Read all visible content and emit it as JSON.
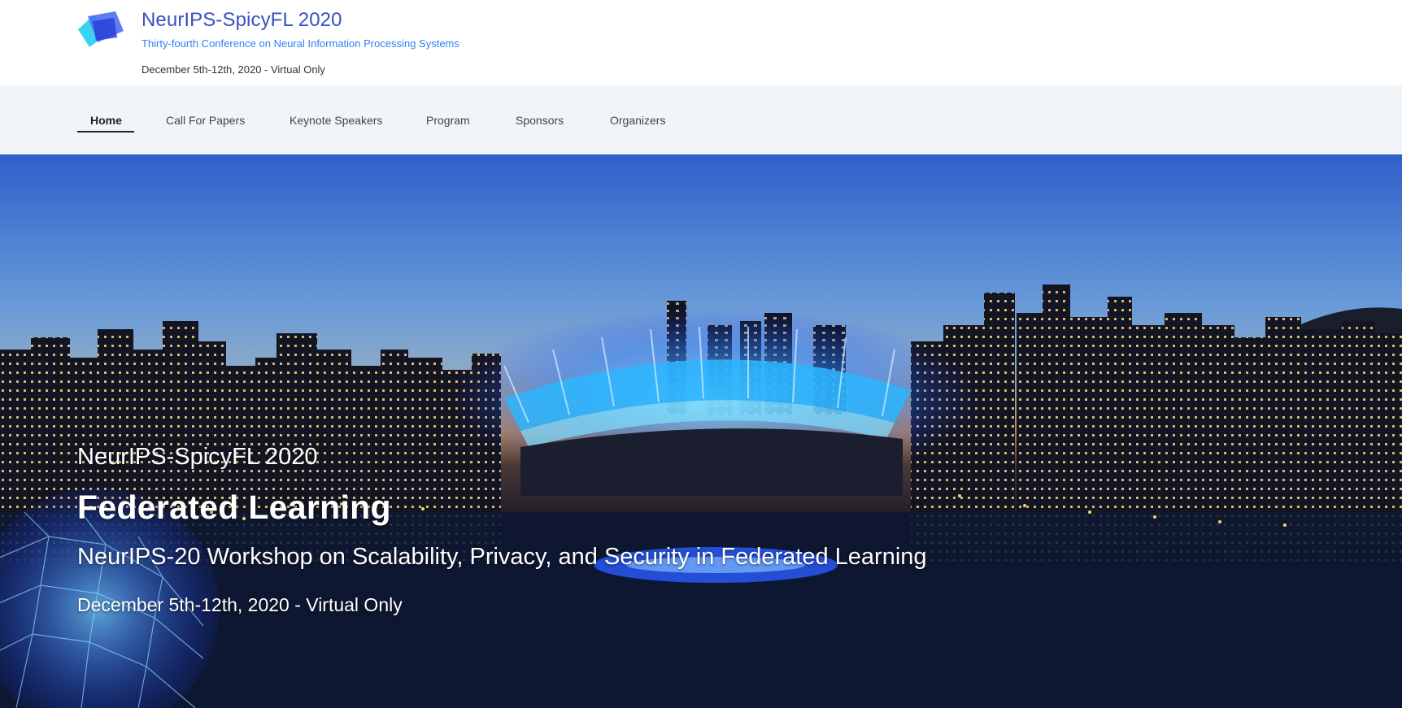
{
  "header": {
    "title": "NeurIPS-SpicyFL 2020",
    "subtitle": "Thirty-fourth Conference on Neural Information Processing Systems",
    "dates": "December 5th-12th, 2020 - Virtual Only",
    "logo_icon": "layered-squares-logo"
  },
  "nav": {
    "items": [
      {
        "label": "Home",
        "active": true
      },
      {
        "label": "Call For Papers",
        "active": false
      },
      {
        "label": "Keynote Speakers",
        "active": false
      },
      {
        "label": "Program",
        "active": false
      },
      {
        "label": "Sponsors",
        "active": false
      },
      {
        "label": "Organizers",
        "active": false
      }
    ]
  },
  "hero": {
    "eyebrow": "NeurIPS-SpicyFL 2020",
    "title": "Federated Learning",
    "subtitle": "NeurIPS-20 Workshop on Scalability, Privacy, and Security in Federated Learning",
    "dates": "December 5th-12th, 2020 - Virtual Only",
    "image": "vancouver-night-skyline-stadium"
  },
  "colors": {
    "title_blue": "#3a4fc7",
    "subtitle_blue": "#2f80ed",
    "nav_bg": "#f2f5f8",
    "stadium_glow": "#3fa9ff"
  }
}
